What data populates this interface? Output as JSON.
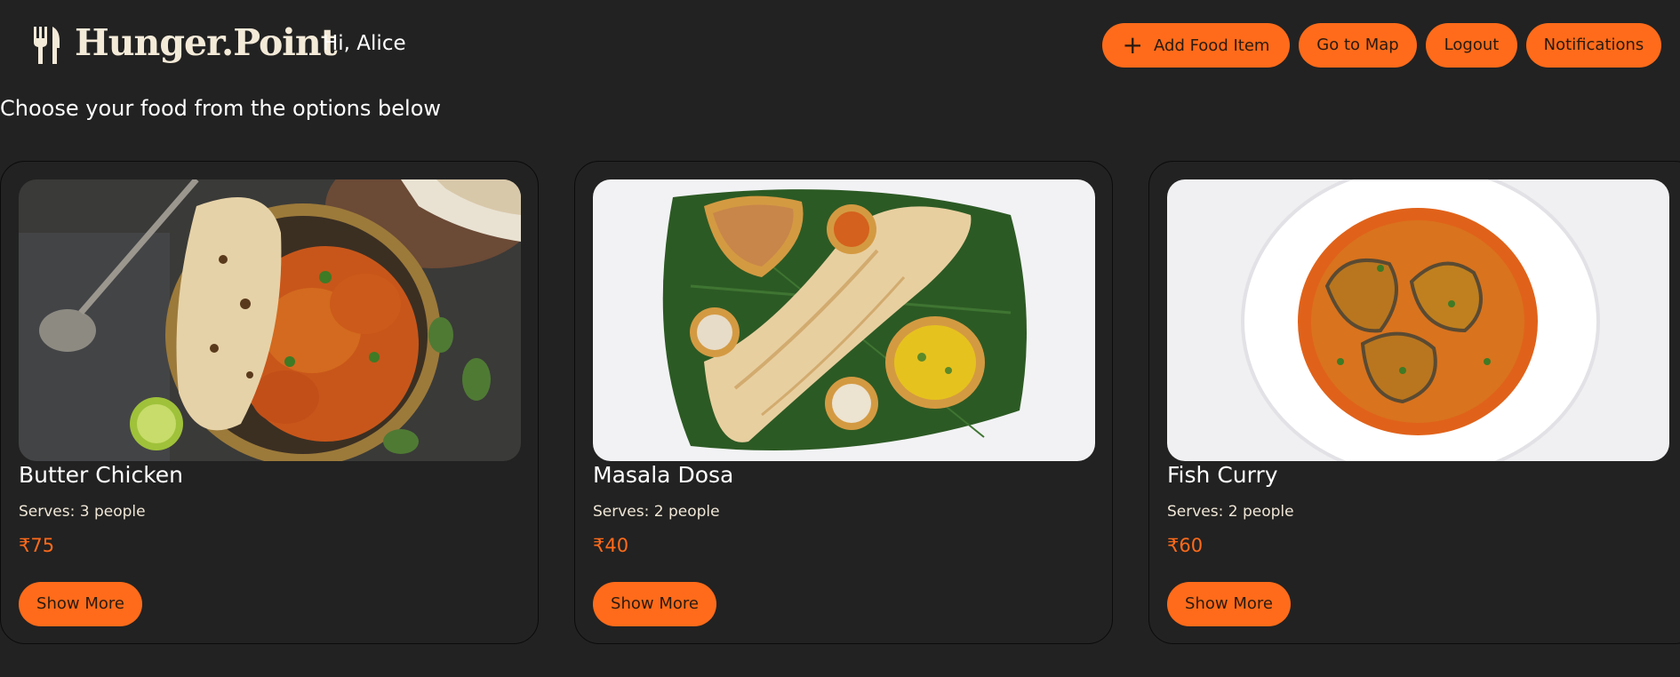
{
  "header": {
    "brand": "Hunger.Point",
    "greeting": "Hi, Alice",
    "buttons": {
      "add_food": "Add Food Item",
      "map": "Go to Map",
      "logout": "Logout",
      "notifications": "Notifications"
    }
  },
  "page": {
    "subtitle": "Choose your food from the options below"
  },
  "foods": [
    {
      "name": "Butter Chicken",
      "serves": "Serves: 3 people",
      "price": "₹75",
      "button": "Show More"
    },
    {
      "name": "Masala Dosa",
      "serves": "Serves: 2 people",
      "price": "₹40",
      "button": "Show More"
    },
    {
      "name": "Fish Curry",
      "serves": "Serves: 2 people",
      "price": "₹60",
      "button": "Show More"
    }
  ],
  "icons": {
    "logo": "fork-knife-icon",
    "add": "plus-icon"
  },
  "colors": {
    "background": "#222222",
    "accent": "#ff6b1a",
    "text": "#f4ead8"
  }
}
